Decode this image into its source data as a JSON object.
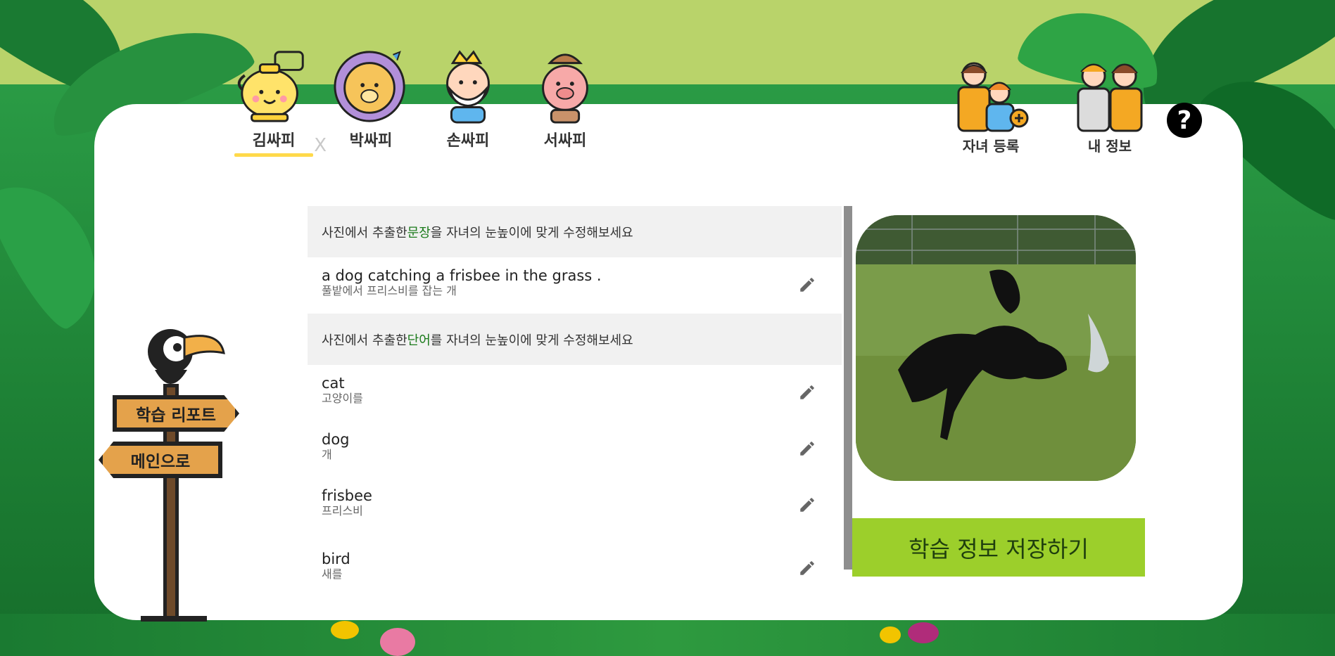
{
  "kids": [
    {
      "name": "김싸피",
      "active": true,
      "remove": "X"
    },
    {
      "name": "박싸피"
    },
    {
      "name": "손싸피"
    },
    {
      "name": "서싸피"
    }
  ],
  "header": {
    "register_child": "자녀 등록",
    "my_info": "내 정보",
    "help": "?"
  },
  "signs": {
    "report": "학습 리포트",
    "main": "메인으로"
  },
  "sentence_section": {
    "prefix": "사진에서 추출한 ",
    "highlight": "문장",
    "suffix": "을 자녀의 눈높이에 맞게 수정해보세요"
  },
  "sentence": {
    "en": "a dog catching a frisbee in the grass .",
    "ko": "풀밭에서 프리스비를 잡는 개"
  },
  "word_section": {
    "prefix": "사진에서 추출한 ",
    "highlight": "단어",
    "suffix": "를 자녀의 눈높이에 맞게 수정해보세요"
  },
  "words": [
    {
      "en": "cat",
      "ko": "고양이를"
    },
    {
      "en": "dog",
      "ko": "개"
    },
    {
      "en": "frisbee",
      "ko": "프리스비"
    },
    {
      "en": "bird",
      "ko": "새를"
    }
  ],
  "save_button": "학습 정보 저장하기",
  "colors": {
    "accent_green": "#9ccf2b",
    "highlight_text": "#1a7a1a",
    "active_underline": "#ffd94a"
  }
}
